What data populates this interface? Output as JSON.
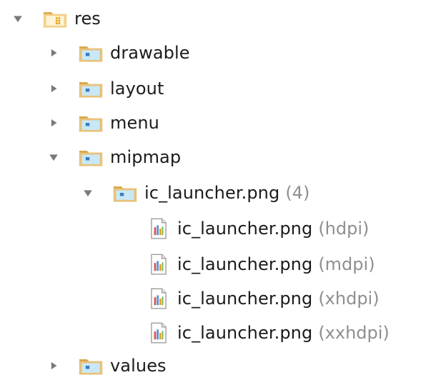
{
  "tree": {
    "root": {
      "label": "res",
      "expanded": true,
      "icon": "res-folder-icon"
    },
    "folders": [
      {
        "key": "drawable",
        "label": "drawable",
        "expanded": false,
        "icon": "folder-icon"
      },
      {
        "key": "layout",
        "label": "layout",
        "expanded": false,
        "icon": "folder-icon"
      },
      {
        "key": "menu",
        "label": "menu",
        "expanded": false,
        "icon": "folder-icon"
      },
      {
        "key": "mipmap",
        "label": "mipmap",
        "expanded": true,
        "icon": "folder-icon"
      },
      {
        "key": "values",
        "label": "values",
        "expanded": false,
        "icon": "folder-icon"
      }
    ],
    "mipmap_group": {
      "label": "ic_launcher.png",
      "qualifier": "(4)",
      "expanded": true,
      "icon": "folder-icon"
    },
    "files": [
      {
        "label": "ic_launcher.png",
        "qualifier": "(hdpi)",
        "icon": "image-file-icon"
      },
      {
        "label": "ic_launcher.png",
        "qualifier": "(mdpi)",
        "icon": "image-file-icon"
      },
      {
        "label": "ic_launcher.png",
        "qualifier": "(xhdpi)",
        "icon": "image-file-icon"
      },
      {
        "label": "ic_launcher.png",
        "qualifier": "(xxhdpi)",
        "icon": "image-file-icon"
      }
    ]
  },
  "colors": {
    "folder_body": "#e8c27a",
    "folder_tab": "#d9a84a",
    "folder_inner": "#bfe3f3",
    "folder_dot": "#3a7bbf",
    "arrow": "#7a7a7a",
    "label": "#1b1b1b",
    "qualifier": "#8f8f8f"
  }
}
